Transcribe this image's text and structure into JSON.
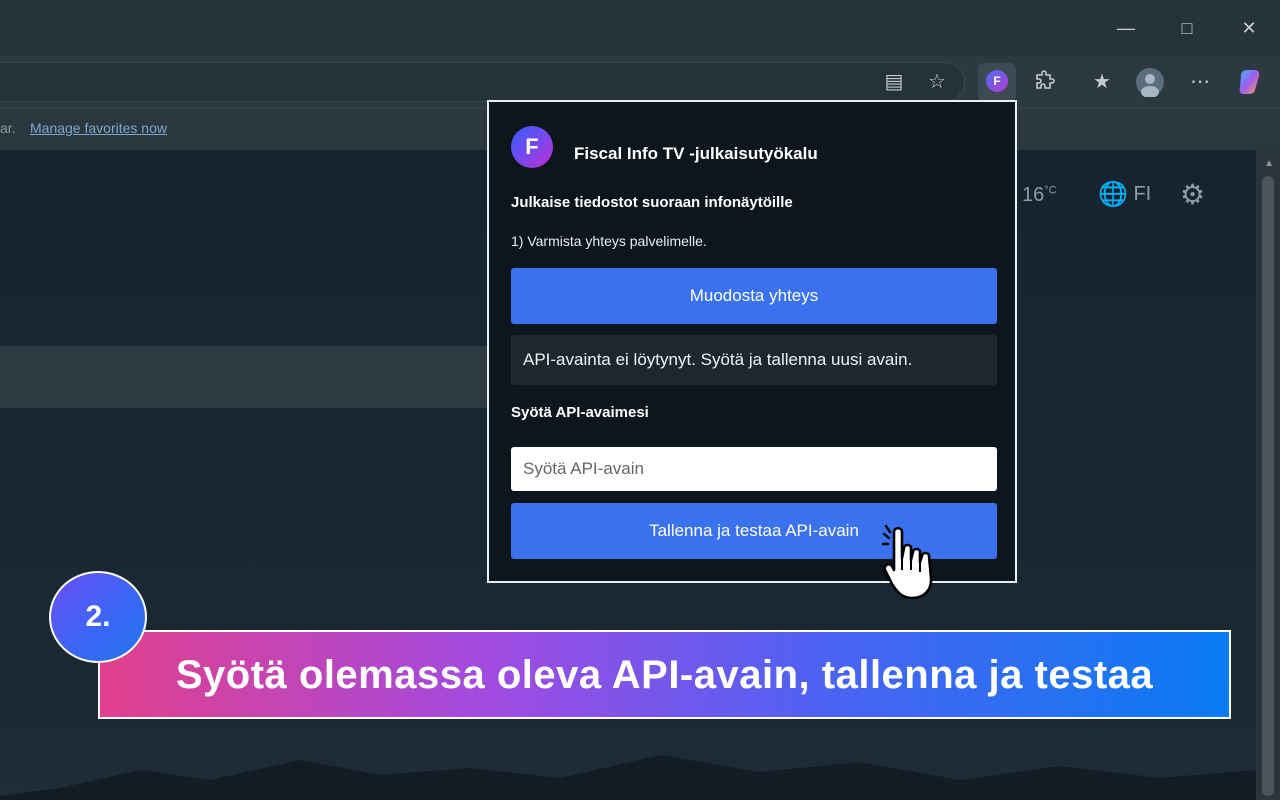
{
  "browser": {
    "favorites_bar_text": "ar.",
    "favorites_link": "Manage favorites now"
  },
  "newtab": {
    "weather": "16",
    "weather_unit": "°C",
    "language": "FI"
  },
  "popup": {
    "logo_letter": "F",
    "title": "Fiscal Info TV -julkaisutyökalu",
    "subtitle": "Julkaise tiedostot suoraan infonäytöille",
    "step1": "1) Varmista yhteys palvelimelle.",
    "connect_button": "Muodosta yhteys",
    "status_message": "API-avainta ei löytynyt. Syötä ja tallenna uusi avain.",
    "api_label": "Syötä API-avaimesi",
    "api_input_value": "",
    "api_input_placeholder": "Syötä API-avain",
    "save_button": "Tallenna ja testaa API-avain"
  },
  "banner": {
    "step_number": "2.",
    "text": "Syötä olemassa oleva API-avain, tallenna ja testaa"
  },
  "colors": {
    "primary_button": "#3a71ef",
    "popup_background": "#0e161d",
    "banner_gradient_start": "#e2408d",
    "banner_gradient_end": "#0a7bf2"
  },
  "icons": [
    "minimize-icon",
    "maximize-icon",
    "close-icon",
    "reading-view-icon",
    "favorite-star-icon",
    "extension-fiscal-icon",
    "puzzle-extensions-icon",
    "favorites-list-icon",
    "profile-avatar-icon",
    "more-menu-icon",
    "copilot-icon",
    "globe-icon",
    "gear-icon",
    "hand-pointer-icon"
  ]
}
